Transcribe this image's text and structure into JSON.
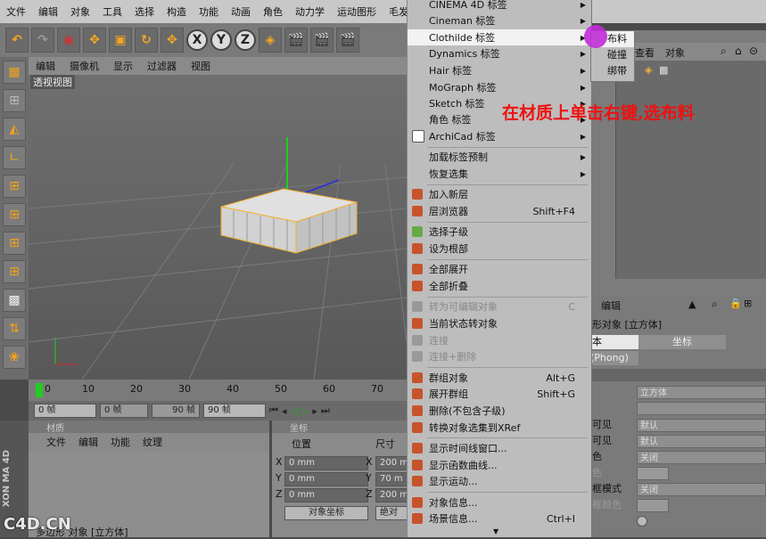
{
  "menubar": {
    "items": [
      "文件",
      "编辑",
      "对象",
      "工具",
      "选择",
      "构造",
      "功能",
      "动画",
      "角色",
      "动力学",
      "运动图形",
      "毛发"
    ]
  },
  "toolbar": {
    "x_label": "X",
    "y_label": "Y",
    "z_label": "Z"
  },
  "viewport": {
    "menu": [
      "编辑",
      "摄像机",
      "显示",
      "过滤器",
      "视图"
    ],
    "label": "透视视图"
  },
  "timeline": {
    "ticks": [
      "0",
      "10",
      "20",
      "30",
      "40",
      "50",
      "60",
      "70"
    ],
    "start_frame": "0 帧",
    "mid_frame": "0 帧",
    "mid_frame_right": "90 帧",
    "end_frame": "90 帧"
  },
  "material_panel": {
    "title": "材质",
    "menu": [
      "文件",
      "编辑",
      "功能",
      "纹理"
    ]
  },
  "coord_panel": {
    "title": "坐标",
    "headers": [
      "位置",
      "尺寸"
    ],
    "rows": [
      {
        "axis": "X",
        "pos": "0 mm",
        "axis2": "X",
        "size": "200 m"
      },
      {
        "axis": "Y",
        "pos": "0 mm",
        "axis2": "Y",
        "size": "70 m"
      },
      {
        "axis": "Z",
        "pos": "0 mm",
        "axis2": "Z",
        "size": "200 m"
      }
    ],
    "mode_left": "对象坐标",
    "mode_right": "绝对"
  },
  "status": {
    "text": "多边形 对象 [立方体]"
  },
  "context_menu": {
    "items": [
      {
        "label": "CINEMA 4D 标签",
        "arrow": true
      },
      {
        "label": "Cineman 标签",
        "arrow": true
      },
      {
        "label": "Clothilde 标签",
        "arrow": true,
        "selected": true
      },
      {
        "label": "Dynamics 标签",
        "arrow": true
      },
      {
        "label": "Hair 标签",
        "arrow": true
      },
      {
        "label": "MoGraph 标签",
        "arrow": true
      },
      {
        "label": "Sketch 标签",
        "arrow": true
      },
      {
        "label": "角色 标签",
        "arrow": true
      },
      {
        "label": "ArchiCad 标签",
        "arrow": true
      },
      {
        "label": "加载标签预制",
        "arrow": true
      },
      {
        "label": "恢复选集",
        "arrow": true
      },
      {
        "label": "加入新层"
      },
      {
        "label": "层浏览器",
        "shortcut": "Shift+F4"
      },
      {
        "label": "选择子级"
      },
      {
        "label": "设为根部"
      },
      {
        "label": "全部展开"
      },
      {
        "label": "全部折叠"
      },
      {
        "label": "转为可编辑对象",
        "shortcut": "C",
        "disabled": true
      },
      {
        "label": "当前状态转对象"
      },
      {
        "label": "连接",
        "disabled": true
      },
      {
        "label": "连接+删除",
        "disabled": true
      },
      {
        "label": "群组对象",
        "shortcut": "Alt+G"
      },
      {
        "label": "展开群组",
        "shortcut": "Shift+G"
      },
      {
        "label": "删除(不包含子级)"
      },
      {
        "label": "转换对象选集到XRef"
      },
      {
        "label": "显示时间线窗口..."
      },
      {
        "label": "显示函数曲线..."
      },
      {
        "label": "显示运动..."
      },
      {
        "label": "对象信息..."
      },
      {
        "label": "场景信息...",
        "shortcut": "Ctrl+I"
      }
    ]
  },
  "submenu": {
    "items": [
      "布料",
      "碰撞",
      "绑带"
    ]
  },
  "object_manager": {
    "menu": [
      "查看",
      "对象"
    ]
  },
  "annotation": "在材质上单击右键,选布料",
  "attributes": {
    "menu": "编辑",
    "object_title": "形对象 [立方体]",
    "tabs": [
      "本",
      "坐标"
    ],
    "phong": "(Phong)",
    "name_value": "立方体",
    "rows": [
      {
        "label": "可见",
        "value": "默认"
      },
      {
        "label": "可见",
        "value": "默认"
      },
      {
        "label": "色",
        "value": "关闭"
      },
      {
        "label": "色",
        "value": ""
      },
      {
        "label": "框模式",
        "value": "关闭"
      },
      {
        "label": "框颜色",
        "value": ""
      }
    ]
  },
  "watermark": "C4D.CN",
  "brand_vertical": "XON MA 4D"
}
